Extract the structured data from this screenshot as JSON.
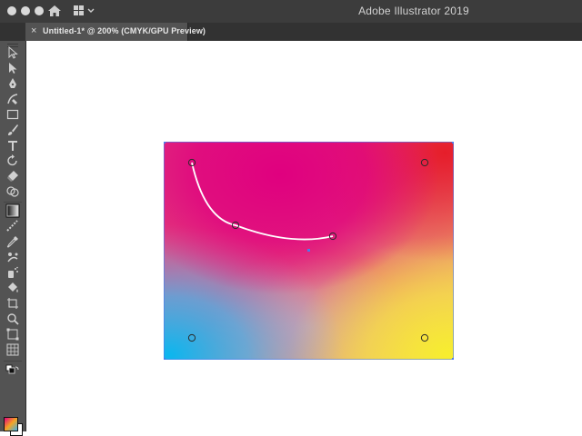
{
  "window": {
    "app_title": "Adobe Illustrator 2019",
    "traffic_lights": [
      "close",
      "minimize",
      "zoom"
    ],
    "home_icon": "home-icon",
    "workspace_icon": "workspace-switcher-icon"
  },
  "tabs": [
    {
      "label": "Untitled-1* @ 200% (CMYK/GPU Preview)",
      "close": "×",
      "active": true
    }
  ],
  "toolbar": {
    "tools": [
      "selection-tool",
      "direct-selection-tool",
      "pen-tool",
      "curvature-tool",
      "rectangle-tool",
      "paintbrush-tool",
      "type-tool",
      "rotate-tool",
      "eraser-tool",
      "shape-builder-tool",
      "gradient-tool",
      "blend-tool",
      "eyedropper-tool",
      "puppet-warp-tool",
      "symbol-sprayer-tool",
      "live-paint-tool",
      "artboard-tool",
      "zoom-tool",
      "free-transform-tool",
      "mesh-tool"
    ],
    "active_tool": "gradient-tool"
  },
  "canvas": {
    "colors": {
      "magenta": "#e5007d",
      "red": "#e4322b",
      "cyan": "#1eb4ea",
      "yellow": "#f5e83a",
      "selection": "#4b7bec"
    }
  }
}
